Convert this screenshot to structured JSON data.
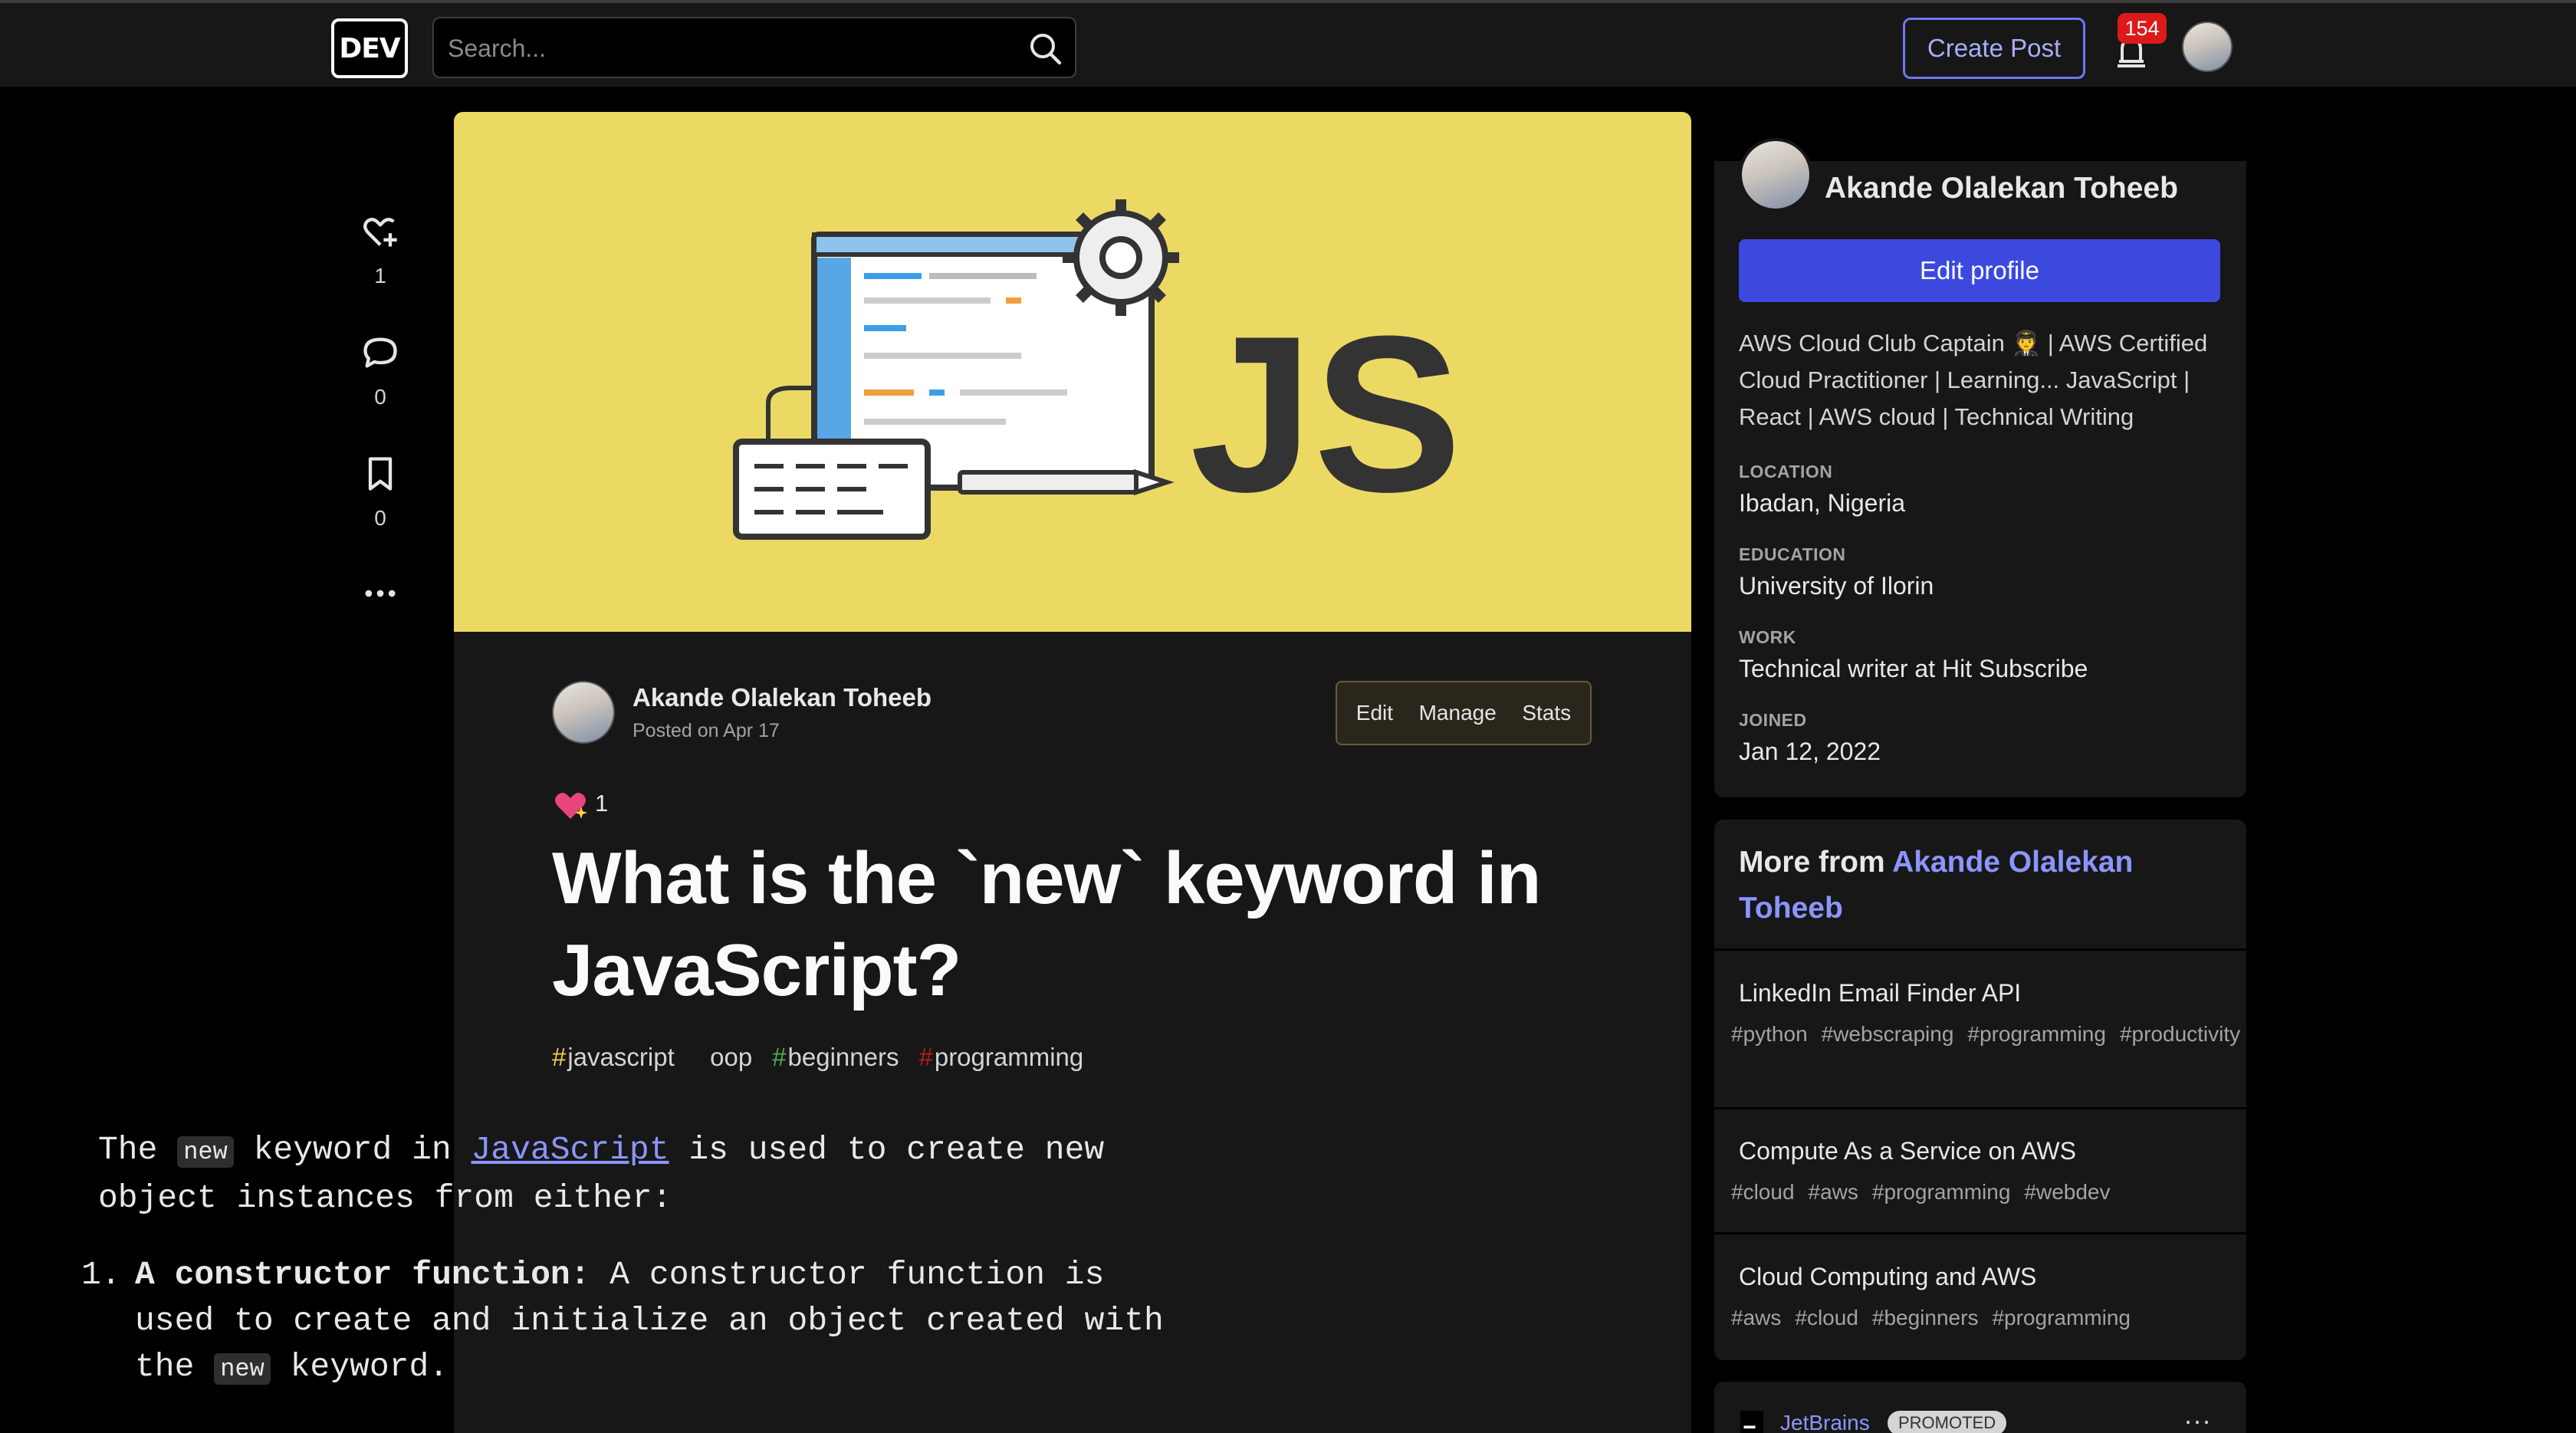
{
  "header": {
    "logo": "DEV",
    "search_placeholder": "Search...",
    "create_post": "Create Post",
    "notification_count": "154"
  },
  "rail": {
    "reactions": "1",
    "comments": "0",
    "bookmarks": "0"
  },
  "article": {
    "cover_text": "JS",
    "author": "Akande Olalekan Toheeb",
    "posted": "Posted on Apr 17",
    "actions": [
      "Edit",
      "Manage",
      "Stats"
    ],
    "reaction_count": "1",
    "title": "What is the `new` keyword in JavaScript?",
    "tags": [
      {
        "hash": "#",
        "name": "javascript",
        "color": "#e8d44d"
      },
      {
        "hash": "#",
        "name": "oop",
        "color": "#171717"
      },
      {
        "hash": "#",
        "name": "beginners",
        "color": "#4caf50"
      },
      {
        "hash": "#",
        "name": "programming",
        "color": "#b71c1c"
      }
    ],
    "body": {
      "p1_a": "The ",
      "p1_code": "new",
      "p1_b": " keyword in ",
      "p1_link": "JavaScript",
      "p1_c": " is used to create new object instances from either:",
      "li1_num": "1.",
      "li1_bold": "A constructor function:",
      "li1_a": " A constructor function is used to create and initialize an object created with the ",
      "li1_code": "new",
      "li1_b": " keyword."
    }
  },
  "profile": {
    "name": "Akande Olalekan Toheeb",
    "edit_profile": "Edit profile",
    "bio": "AWS Cloud Club Captain 🧑‍✈️ | AWS Certified Cloud Practitioner | Learning... JavaScript | React | AWS cloud | Technical Writing",
    "location_label": "LOCATION",
    "location": "Ibadan, Nigeria",
    "education_label": "EDUCATION",
    "education": "University of Ilorin",
    "work_label": "WORK",
    "work": "Technical writer at Hit Subscribe",
    "joined_label": "JOINED",
    "joined": "Jan 12, 2022"
  },
  "more_from": {
    "prefix": "More from ",
    "author": "Akande Olalekan Toheeb",
    "items": [
      {
        "title": "LinkedIn Email Finder API",
        "tags": [
          "#python",
          "#webscraping",
          "#programming",
          "#productivity"
        ]
      },
      {
        "title": "Compute As a Service on AWS",
        "tags": [
          "#cloud",
          "#aws",
          "#programming",
          "#webdev"
        ]
      },
      {
        "title": "Cloud Computing and AWS",
        "tags": [
          "#aws",
          "#cloud",
          "#beginners",
          "#programming"
        ]
      }
    ]
  },
  "promo": {
    "name": "JetBrains",
    "badge": "PROMOTED",
    "more": "···"
  },
  "colors": {
    "accent": "#3b49df",
    "link": "#8b95ff",
    "cover": "#ecd964",
    "badge_red": "#dc1a1a"
  }
}
